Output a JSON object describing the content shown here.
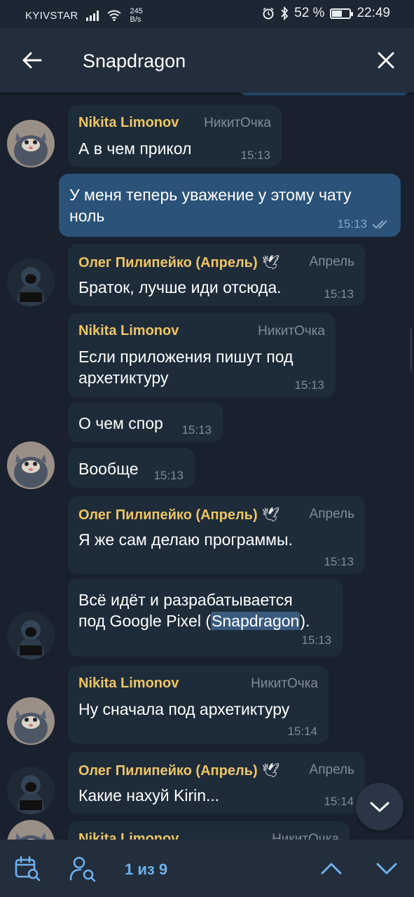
{
  "status_bar": {
    "carrier": "KYIVSTAR",
    "speed_value": "245",
    "speed_unit": "B/s",
    "battery": "52 %",
    "battery_level": 0.52,
    "time": "22:49"
  },
  "header": {
    "search_query": "Snapdragon",
    "back_icon": "arrow-left-icon",
    "close_icon": "close-icon"
  },
  "messages": [
    {
      "name": "Nikita Limonov",
      "rank": "НикитОчка",
      "text": "А в чем прикол",
      "time": "15:13"
    },
    {
      "out": true,
      "lines": [
        "У меня теперь уважение у этому чату",
        "ноль"
      ],
      "time": "15:13"
    },
    {
      "name": "Олег Пилипейко (Апрель)",
      "dove": "🕊",
      "rank": "Апрель",
      "text": "Браток, лучше иди отсюда.",
      "time": "15:13"
    },
    {
      "name": "Nikita Limonov",
      "rank": "НикитОчка",
      "lines": [
        "Если приложения пишут под",
        "архетиктуру"
      ],
      "time": "15:13"
    },
    {
      "text": "О чем спор",
      "time": "15:13"
    },
    {
      "text": "Вообще",
      "time": "15:13"
    },
    {
      "name": "Олег Пилипейко (Апрель)",
      "dove": "🕊",
      "rank": "Апрель",
      "text": "Я же сам делаю программы.",
      "time": "15:13"
    },
    {
      "line1": "Всё идёт и разрабатывается",
      "line2_before": "под Google Pixel (",
      "line2_highlight": "Snapdragon",
      "line2_after": ").",
      "time": "15:13"
    },
    {
      "name": "Nikita Limonov",
      "rank": "НикитОчка",
      "text": "Ну сначала под архетиктуру",
      "time": "15:14"
    },
    {
      "name": "Олег Пилипейко (Апрель)",
      "dove": "🕊",
      "rank": "Апрель",
      "text": "Какие нахуй Kirin...",
      "time": "15:14"
    },
    {
      "name": "Nikita Limonov",
      "rank": "НикитОчка"
    }
  ],
  "bottom_bar": {
    "counter": "1 из 9",
    "calendar_icon": "calendar-search-icon",
    "user_icon": "user-search-icon",
    "up_icon": "chevron-up-icon",
    "down_icon": "chevron-down-icon"
  },
  "colors": {
    "background": "#18212d",
    "header": "#232e3c",
    "incoming_bubble": "#1e2c3a",
    "outgoing_bubble": "#2b5278",
    "name": "#eec562",
    "accent": "#6fb0ec"
  }
}
